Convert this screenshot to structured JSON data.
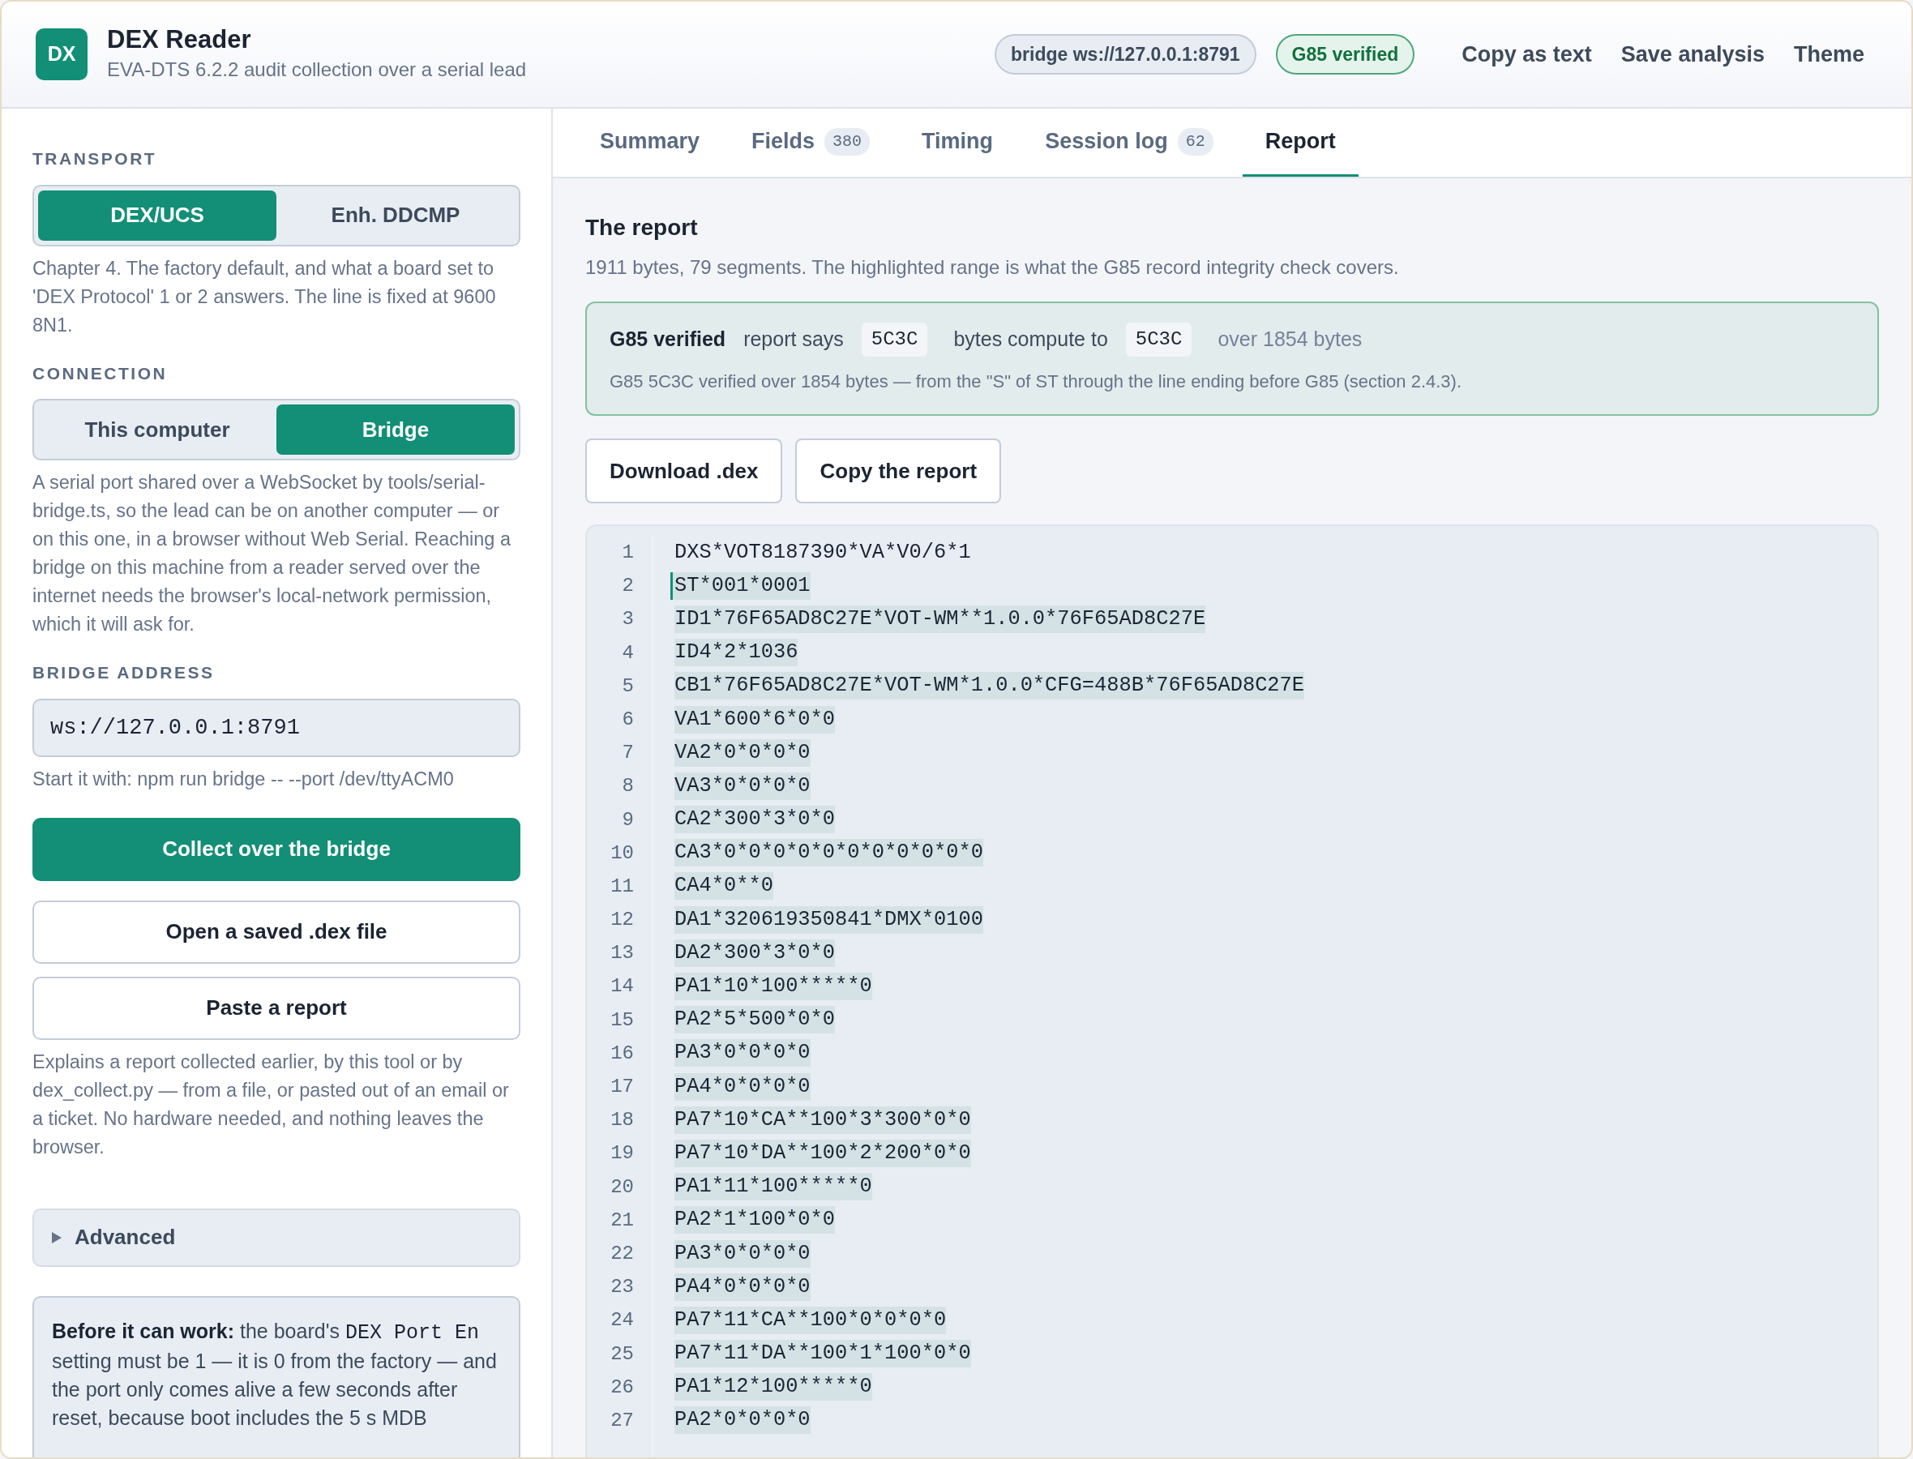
{
  "app": {
    "logo": "DX",
    "title": "DEX Reader",
    "subtitle": "EVA-DTS 6.2.2 audit collection over a serial lead"
  },
  "header_pills": [
    {
      "label": "bridge ws://127.0.0.1:8791",
      "kind": "neutral"
    },
    {
      "label": "G85 verified",
      "kind": "ok"
    }
  ],
  "header_actions": [
    "Copy as text",
    "Save analysis",
    "Theme"
  ],
  "sidebar": {
    "transport": {
      "heading": "TRANSPORT",
      "options": [
        {
          "label": "DEX/UCS",
          "selected": true
        },
        {
          "label": "Enh. DDCMP",
          "selected": false
        }
      ],
      "help": "Chapter 4. The factory default, and what a board set to 'DEX Protocol' 1 or 2 answers. The line is fixed at 9600 8N1."
    },
    "connection": {
      "heading": "CONNECTION",
      "options": [
        {
          "label": "This computer",
          "selected": false
        },
        {
          "label": "Bridge",
          "selected": true
        }
      ],
      "help": "A serial port shared over a WebSocket by tools/serial-bridge.ts, so the lead can be on another computer — or on this one, in a browser without Web Serial. Reaching a bridge on this machine from a reader served over the internet needs the browser's local-network permission, which it will ask for."
    },
    "bridge_address": {
      "heading": "BRIDGE ADDRESS",
      "value": "ws://127.0.0.1:8791",
      "hint": "Start it with: npm run bridge -- --port /dev/ttyACM0"
    },
    "buttons": [
      {
        "label": "Collect over the bridge",
        "kind": "primary"
      },
      {
        "label": "Open a saved .dex file",
        "kind": "outline"
      },
      {
        "label": "Paste a report",
        "kind": "outline"
      }
    ],
    "help": "Explains a report collected earlier, by this tool or by dex_collect.py — from a file, or pasted out of an email or a ticket. No hardware needed, and nothing leaves the browser.",
    "advanced": {
      "label": "Advanced",
      "expanded": false
    },
    "note": {
      "lead": "Before it can work:",
      "before": "the board's",
      "code": "DEX Port En",
      "after": "setting must be 1 — it is 0 from the factory — and the port only comes alive a few seconds after reset, because boot includes the 5 s MDB"
    }
  },
  "tabs": [
    {
      "label": "Summary",
      "selected": false
    },
    {
      "label": "Fields",
      "count": "380",
      "selected": false
    },
    {
      "label": "Timing",
      "selected": false
    },
    {
      "label": "Session log",
      "count": "62",
      "selected": false
    },
    {
      "label": "Report",
      "selected": true
    }
  ],
  "report": {
    "title": "The report",
    "summary": "1911 bytes, 79 segments. The highlighted range is what the G85 record integrity check covers.",
    "check": {
      "verified": true,
      "title": "G85 verified",
      "says_label": "report says",
      "says": "5C3C",
      "compute_label": "bytes compute to",
      "compute": "5C3C",
      "over": "over 1854 bytes",
      "detail": "G85 5C3C verified over 1854 bytes — from the \"S\" of ST through the line ending before G85 (section 2.4.3)."
    },
    "buttons": [
      "Download .dex",
      "Copy the report"
    ],
    "lines": [
      {
        "n": "1",
        "text": "DXS*VOT8187390*VA*V0/6*1",
        "highlighted": false,
        "range_start": false
      },
      {
        "n": "2",
        "text": "ST*001*0001",
        "highlighted": true,
        "range_start": true
      },
      {
        "n": "3",
        "text": "ID1*76F65AD8C27E*VOT-WM**1.0.0*76F65AD8C27E",
        "highlighted": true,
        "range_start": false
      },
      {
        "n": "4",
        "text": "ID4*2*1036",
        "highlighted": true,
        "range_start": false
      },
      {
        "n": "5",
        "text": "CB1*76F65AD8C27E*VOT-WM*1.0.0*CFG=488B*76F65AD8C27E",
        "highlighted": true,
        "range_start": false
      },
      {
        "n": "6",
        "text": "VA1*600*6*0*0",
        "highlighted": true,
        "range_start": false
      },
      {
        "n": "7",
        "text": "VA2*0*0*0*0",
        "highlighted": true,
        "range_start": false
      },
      {
        "n": "8",
        "text": "VA3*0*0*0*0",
        "highlighted": true,
        "range_start": false
      },
      {
        "n": "9",
        "text": "CA2*300*3*0*0",
        "highlighted": true,
        "range_start": false
      },
      {
        "n": "10",
        "text": "CA3*0*0*0*0*0*0*0*0*0*0*0",
        "highlighted": true,
        "range_start": false
      },
      {
        "n": "11",
        "text": "CA4*0**0",
        "highlighted": true,
        "range_start": false
      },
      {
        "n": "12",
        "text": "DA1*320619350841*DMX*0100",
        "highlighted": true,
        "range_start": false
      },
      {
        "n": "13",
        "text": "DA2*300*3*0*0",
        "highlighted": true,
        "range_start": false
      },
      {
        "n": "14",
        "text": "PA1*10*100*****0",
        "highlighted": true,
        "range_start": false
      },
      {
        "n": "15",
        "text": "PA2*5*500*0*0",
        "highlighted": true,
        "range_start": false
      },
      {
        "n": "16",
        "text": "PA3*0*0*0*0",
        "highlighted": true,
        "range_start": false
      },
      {
        "n": "17",
        "text": "PA4*0*0*0*0",
        "highlighted": true,
        "range_start": false
      },
      {
        "n": "18",
        "text": "PA7*10*CA**100*3*300*0*0",
        "highlighted": true,
        "range_start": false
      },
      {
        "n": "19",
        "text": "PA7*10*DA**100*2*200*0*0",
        "highlighted": true,
        "range_start": false
      },
      {
        "n": "20",
        "text": "PA1*11*100*****0",
        "highlighted": true,
        "range_start": false
      },
      {
        "n": "21",
        "text": "PA2*1*100*0*0",
        "highlighted": true,
        "range_start": false
      },
      {
        "n": "22",
        "text": "PA3*0*0*0*0",
        "highlighted": true,
        "range_start": false
      },
      {
        "n": "23",
        "text": "PA4*0*0*0*0",
        "highlighted": true,
        "range_start": false
      },
      {
        "n": "24",
        "text": "PA7*11*CA**100*0*0*0*0",
        "highlighted": true,
        "range_start": false
      },
      {
        "n": "25",
        "text": "PA7*11*DA**100*1*100*0*0",
        "highlighted": true,
        "range_start": false
      },
      {
        "n": "26",
        "text": "PA1*12*100*****0",
        "highlighted": true,
        "range_start": false
      },
      {
        "n": "27",
        "text": "PA2*0*0*0*0",
        "highlighted": true,
        "range_start": false
      }
    ]
  }
}
